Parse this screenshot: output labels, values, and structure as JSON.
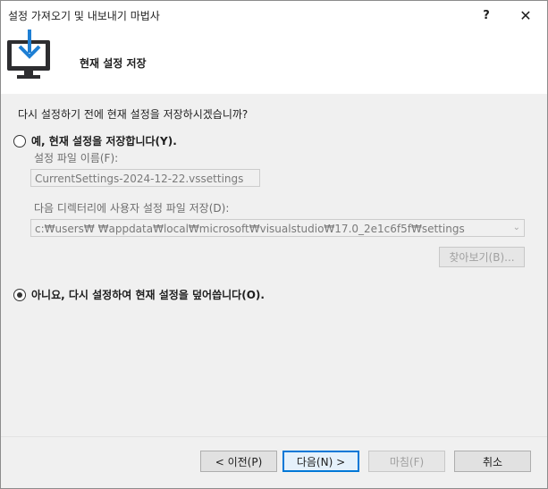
{
  "window": {
    "title": "설정 가져오기 및 내보내기 마법사",
    "help_label": "?",
    "close_label": "✕"
  },
  "header": {
    "title": "현재 설정 저장",
    "icon": "monitor-download-icon"
  },
  "content": {
    "question": "다시 설정하기 전에 현재 설정을 저장하시겠습니까?",
    "option_yes": {
      "label": "예, 현재 설정을 저장합니다(Y).",
      "checked": false
    },
    "file_name_label": "설정 파일 이름(F):",
    "file_name_value": "CurrentSettings-2024-12-22.vssettings",
    "directory_label": "다음 디렉터리에 사용자 설정 파일 저장(D):",
    "directory_value": "c:₩users₩        ₩appdata₩local₩microsoft₩visualstudio₩17.0_2e1c6f5f₩settings",
    "browse_label": "찾아보기(B)...",
    "option_no": {
      "label": "아니요, 다시 설정하여 현재 설정을 덮어씁니다(O).",
      "checked": true
    }
  },
  "footer": {
    "back_label": "< 이전(P)",
    "next_label": "다음(N) >",
    "finish_label": "마침(F)",
    "cancel_label": "취소"
  },
  "colors": {
    "accent": "#0078d7",
    "icon_blue": "#1e7fd4",
    "icon_dark": "#2d2d30"
  }
}
